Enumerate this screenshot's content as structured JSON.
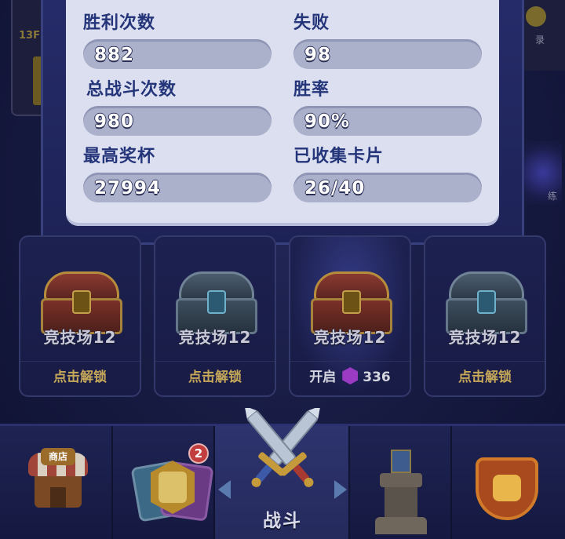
{
  "stats_panel": {
    "wins": {
      "label": "胜利次数",
      "value": "882"
    },
    "losses": {
      "label": "失败",
      "value": "98"
    },
    "total_battles": {
      "label": "总战斗次数",
      "value": "980"
    },
    "win_rate": {
      "label": "胜率",
      "value": "90%"
    },
    "highest_trophies": {
      "label": "最高奖杯",
      "value": "27994"
    },
    "cards_collected": {
      "label": "已收集卡片",
      "value": "26/40"
    }
  },
  "chests": [
    {
      "name": "竞技场12",
      "type": "gold",
      "action": "点击解锁"
    },
    {
      "name": "竞技场12",
      "type": "steel",
      "action": "点击解锁"
    },
    {
      "name": "竞技场12",
      "type": "gold",
      "open_label": "开启",
      "gem_cost": "336"
    },
    {
      "name": "竞技场12",
      "type": "steel",
      "action": "点击解锁"
    }
  ],
  "nav": {
    "shop_sign": "商店",
    "cards_badge": "2",
    "battle_label": "战斗"
  },
  "background": {
    "left_level_text": "13F",
    "right_label_top": "录",
    "right_label_bottom": "练"
  }
}
